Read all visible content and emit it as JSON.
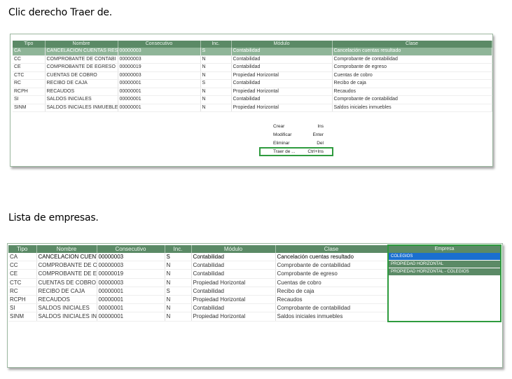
{
  "headings": {
    "first": "Clic derecho Traer de.",
    "second": "Lista de empresas."
  },
  "columns": [
    "Tipo",
    "Nombre",
    "Consecutivo",
    "Inc.",
    "Módulo",
    "Clase"
  ],
  "grid1_rows": [
    [
      "CA",
      "CANCELACION CUENTAS RES",
      "00000003",
      "S",
      "Contabilidad",
      "Cancelación cuentas resultado"
    ],
    [
      "CC",
      "COMPROBANTE DE CONTABI",
      "00000003",
      "N",
      "Contabilidad",
      "Comprobante de contabilidad"
    ],
    [
      "CE",
      "COMPROBANTE DE EGRESO",
      "00000019",
      "N",
      "Contabilidad",
      "Comprobante de egreso"
    ],
    [
      "CTC",
      "CUENTAS DE COBRO",
      "00000003",
      "N",
      "Propiedad Horizontal",
      "Cuentas de cobro"
    ],
    [
      "RC",
      "RECIBO DE CAJA",
      "00000001",
      "S",
      "Contabilidad",
      "Recibo de caja"
    ],
    [
      "RCPH",
      "RECAUDOS",
      "00000001",
      "N",
      "Propiedad Horizontal",
      "Recaudos"
    ],
    [
      "SI",
      "SALDOS INICIALES",
      "00000001",
      "N",
      "Contabilidad",
      "Comprobante de contabilidad"
    ],
    [
      "SINM",
      "SALDOS INICIALES INMUEBLE",
      "00000001",
      "N",
      "Propiedad Horizontal",
      "Saldos iniciales inmuebles"
    ]
  ],
  "grid2_rows": [
    [
      "CA",
      "CANCELACION CUENTA",
      "00000003",
      "S",
      "Contabilidad",
      "Cancelación cuentas resultado"
    ],
    [
      "CC",
      "COMPROBANTE DE CO",
      "00000003",
      "N",
      "Contabilidad",
      "Comprobante de contabilidad"
    ],
    [
      "CE",
      "COMPROBANTE DE EG",
      "00000019",
      "N",
      "Contabilidad",
      "Comprobante de egreso"
    ],
    [
      "CTC",
      "CUENTAS DE COBRO",
      "00000003",
      "N",
      "Propiedad Horizontal",
      "Cuentas de cobro"
    ],
    [
      "RC",
      "RECIBO DE CAJA",
      "00000001",
      "S",
      "Contabilidad",
      "Recibo de caja"
    ],
    [
      "RCPH",
      "RECAUDOS",
      "00000001",
      "N",
      "Propiedad Horizontal",
      "Recaudos"
    ],
    [
      "SI",
      "SALDOS INICIALES",
      "00000001",
      "N",
      "Contabilidad",
      "Comprobante de contabilidad"
    ],
    [
      "SINM",
      "SALDOS INICIALES INM",
      "00000001",
      "N",
      "Propiedad Horizontal",
      "Saldos iniciales inmuebles"
    ]
  ],
  "context_menu": [
    {
      "label": "Crear",
      "shortcut": "Ins"
    },
    {
      "label": "Modificar",
      "shortcut": "Enter"
    },
    {
      "label": "Eliminar",
      "shortcut": "Del"
    },
    {
      "label": "Traer de ...",
      "shortcut": "Ctrl+Ins"
    }
  ],
  "empresa": {
    "header": "Empresa",
    "items": [
      "COLEGIOS",
      "PROPIEDAD HORIZONTAL",
      "PROPIEDAD HORIZONTAL - COLEGIOS"
    ]
  },
  "colors": {
    "header_green": "#5b8a66",
    "selected_row": "#8fb598",
    "highlight_border": "#2e9b3e",
    "active_item": "#1a6fd0"
  }
}
